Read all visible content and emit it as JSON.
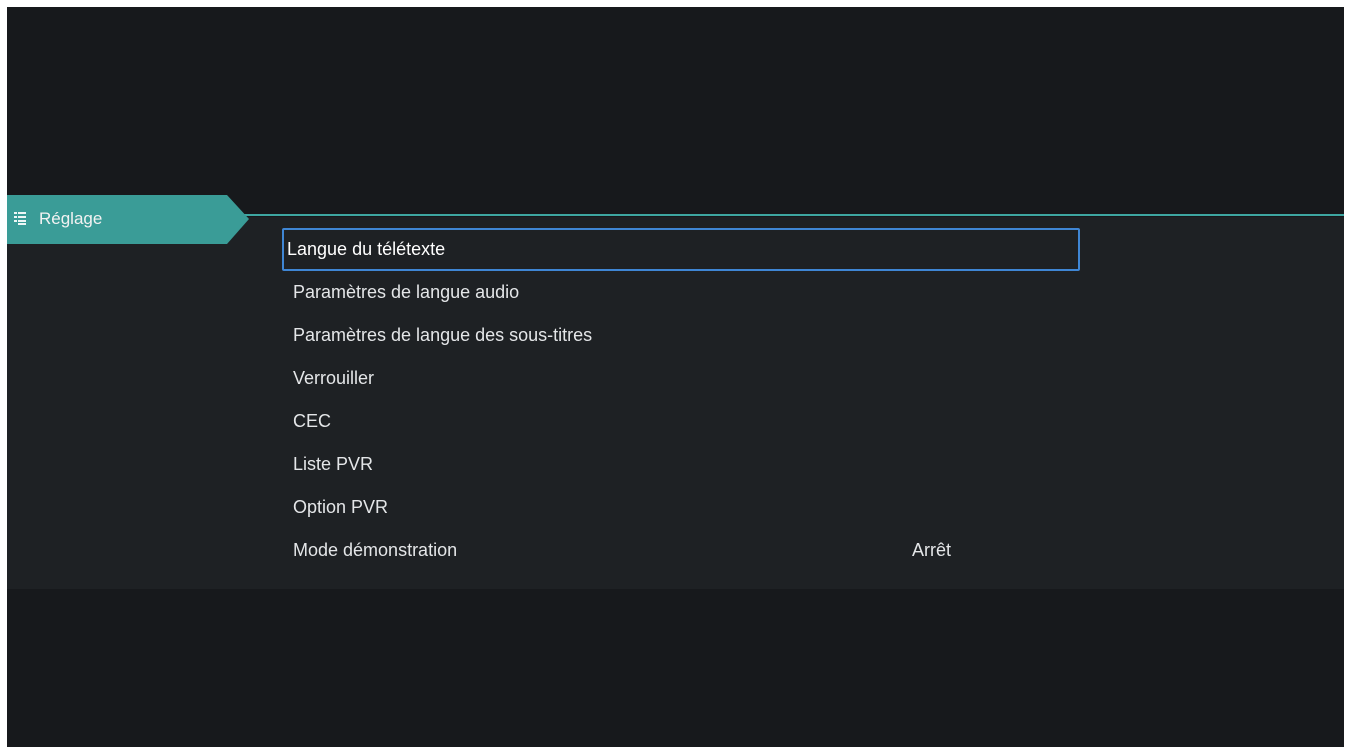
{
  "tab": {
    "label": "Réglage",
    "icon": "list-icon",
    "color": "#3a9c97"
  },
  "menu": {
    "items": [
      {
        "label": "Langue du télétexte",
        "value": ""
      },
      {
        "label": "Paramètres de langue audio",
        "value": ""
      },
      {
        "label": "Paramètres de langue des sous-titres",
        "value": ""
      },
      {
        "label": "Verrouiller",
        "value": ""
      },
      {
        "label": "CEC",
        "value": ""
      },
      {
        "label": "Liste PVR",
        "value": ""
      },
      {
        "label": "Option PVR",
        "value": ""
      },
      {
        "label": "Mode démonstration",
        "value": "Arrêt"
      }
    ],
    "focused_index": 0
  },
  "colors": {
    "accent": "#3ea6a1",
    "focus": "#3f86d4",
    "background": "#17191c",
    "panel": "#1e2124"
  }
}
